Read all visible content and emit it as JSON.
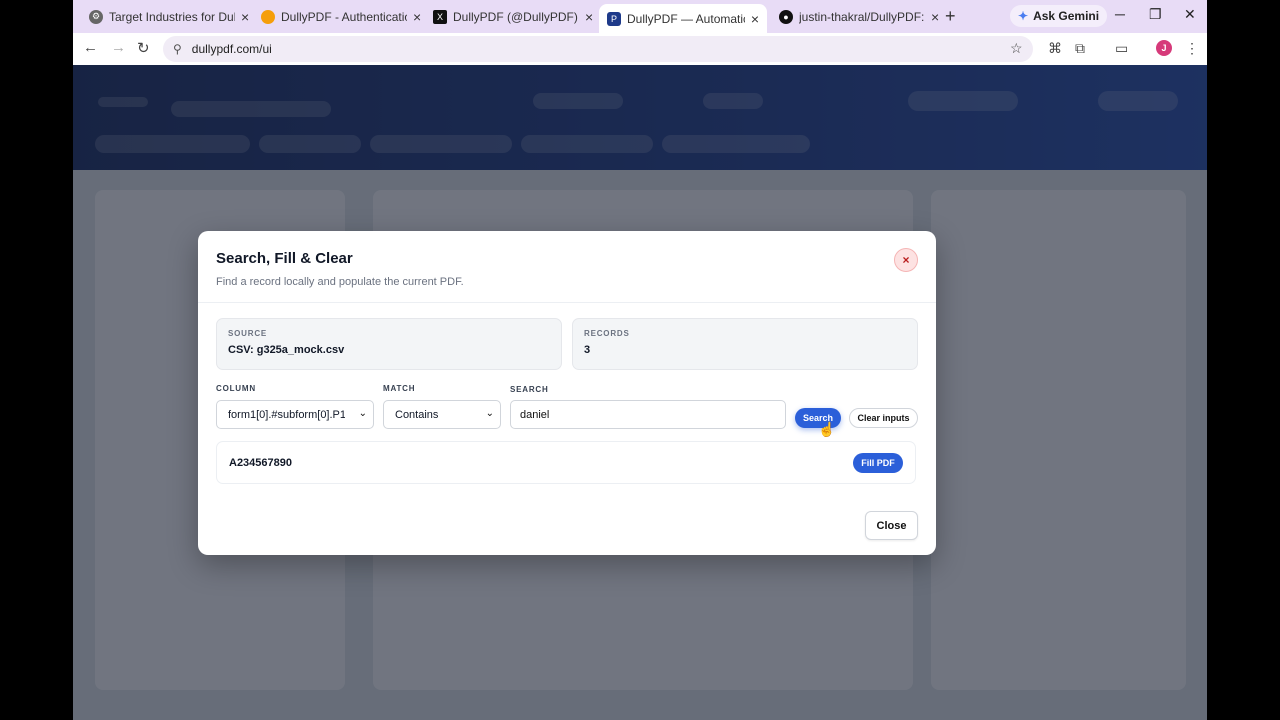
{
  "browser": {
    "tabs": [
      {
        "title": "Target Industries for DullyPDF",
        "favicon_color": "#555555",
        "favicon_glyph": "gear-icon"
      },
      {
        "title": "DullyPDF - Authentication - Fi",
        "favicon_color": "#f59e0b",
        "favicon_glyph": "firebase-icon"
      },
      {
        "title": "DullyPDF (@DullyPDF) / X",
        "favicon_color": "#111111",
        "favicon_glyph": "x-icon"
      },
      {
        "title": "DullyPDF — Automatic PDF to",
        "favicon_color": "#1e3a8a",
        "favicon_glyph": "dullypdf-icon"
      },
      {
        "title": "justin-thakral/DullyPDF: Dully",
        "favicon_color": "#111111",
        "favicon_glyph": "github-icon"
      }
    ],
    "active_tab_index": 3,
    "new_tab_label": "+",
    "gemini_label": "Ask Gemini",
    "url": "dullypdf.com/ui",
    "profile_initial": "J",
    "profile_color": "#d63a7a"
  },
  "modal": {
    "title": "Search, Fill & Clear",
    "subtitle": "Find a record locally and populate the current PDF.",
    "close_x": "×",
    "source_label": "SOURCE",
    "source_value": "CSV: g325a_mock.csv",
    "records_label": "RECORDS",
    "records_value": "3",
    "column_label": "COLUMN",
    "column_value": "form1[0].#subform[0].P1",
    "match_label": "MATCH",
    "match_value": "Contains",
    "search_label": "SEARCH",
    "search_value": "daniel",
    "search_button": "Search",
    "clear_button": "Clear inputs",
    "result_id": "A234567890",
    "fill_button": "Fill PDF",
    "close_button": "Close"
  },
  "colors": {
    "accent": "#2b5fd9",
    "header_gradient_start": "#1c2f63",
    "header_gradient_end": "#2a4fa8"
  }
}
